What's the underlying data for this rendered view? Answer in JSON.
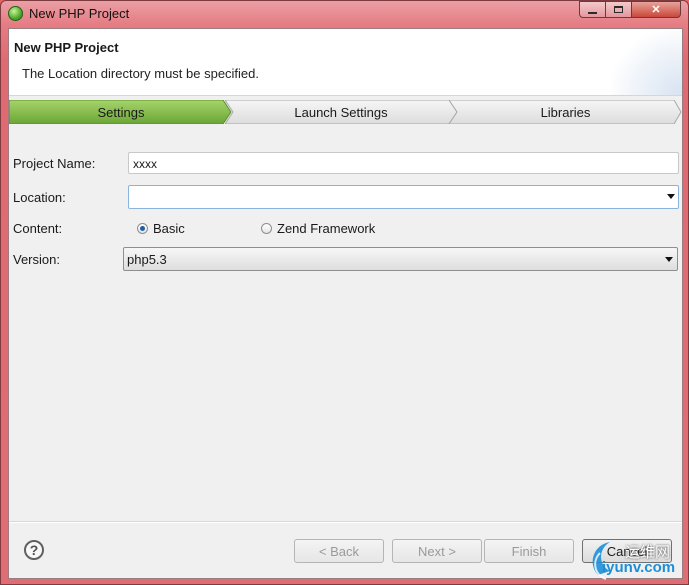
{
  "window": {
    "title": "New PHP Project",
    "controls": {
      "minimize": "minimize-icon",
      "maximize": "maximize-icon",
      "close": "close-icon"
    }
  },
  "header": {
    "title": "New PHP Project",
    "message": "The Location directory must be specified."
  },
  "steps": [
    {
      "label": "Settings",
      "active": true
    },
    {
      "label": "Launch Settings",
      "active": false
    },
    {
      "label": "Libraries",
      "active": false
    }
  ],
  "form": {
    "project_name": {
      "label": "Project Name:",
      "value": "xxxx"
    },
    "location": {
      "label": "Location:",
      "value": ""
    },
    "content": {
      "label": "Content:",
      "options": [
        {
          "label": "Basic",
          "selected": true
        },
        {
          "label": "Zend Framework",
          "selected": false
        }
      ]
    },
    "version": {
      "label": "Version:",
      "value": "php5.3"
    }
  },
  "buttons": {
    "help": "?",
    "back": "< Back",
    "next": "Next >",
    "finish": "Finish",
    "cancel": "Cancel"
  },
  "watermark": {
    "cn": "运维网",
    "url": "iyunv.com"
  },
  "colors": {
    "active_step": "#7db544",
    "inactive_step": "#e8e8e8",
    "window_frame": "#e06c74",
    "client_bg": "#f0f0f0"
  }
}
